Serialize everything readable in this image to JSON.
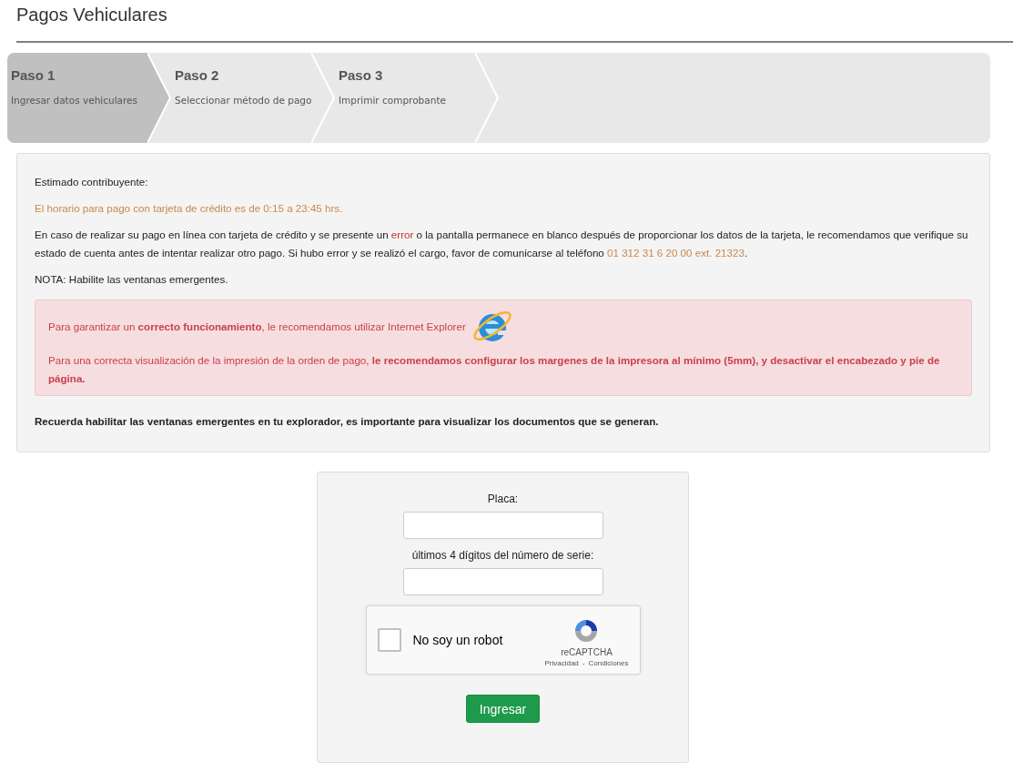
{
  "page": {
    "title": "Pagos Vehiculares"
  },
  "steps": [
    {
      "title": "Paso 1",
      "label": "Ingresar datos vehiculares",
      "selected": true
    },
    {
      "title": "Paso 2",
      "label": "Seleccionar método de pago",
      "selected": false
    },
    {
      "title": "Paso 3",
      "label": "Imprimir comprobante",
      "selected": false
    }
  ],
  "notice": {
    "greeting": "Estimado contribuyente:",
    "schedule": "El horario para pago con tarjeta de crédito es de 0:15 a 23:45 hrs.",
    "paragraph": [
      {
        "kind": "plain",
        "text": "En caso de realizar su pago en línea con tarjeta de crédito y se presente un "
      },
      {
        "kind": "error",
        "text": "error"
      },
      {
        "kind": "plain",
        "text": " o la pantalla permanece en blanco después de proporcionar los datos de la tarjeta, le recomendamos que verifique su estado de cuenta antes de intentar realizar otro pago. Si hubo error y se realizó el cargo, favor de comunicarse al teléfono "
      },
      {
        "kind": "highlight",
        "text": "01 312 31 6 20 00 ext. 21323"
      },
      {
        "kind": "plain",
        "text": "."
      }
    ],
    "note": "NOTA: Habilite las ventanas emergentes.",
    "alert": [
      "Para garantizar un **correcto funcionamiento**, le recomendamos utilizar Internet Explorer",
      "Para una correcta visualización de la impresión de la orden de pago, **le recomendamos configurar los margenes de la impresora al mínimo (5mm), y desactivar el encabezado y pie de página.**"
    ],
    "reminder": "Recuerda habilitar las ventanas emergentes en tu explorador, es importante para visualizar los documentos que se generan."
  },
  "form": {
    "fields": [
      {
        "label": "Placa:"
      },
      {
        "label": "últimos 4 dígitos del número de serie:"
      }
    ],
    "captcha": {
      "label": "No soy un robot",
      "checked": false,
      "brand": "reCAPTCHA",
      "links": [
        "Privacidad",
        "Condiciones"
      ],
      "separator": "-"
    },
    "submit": "Ingresar"
  }
}
